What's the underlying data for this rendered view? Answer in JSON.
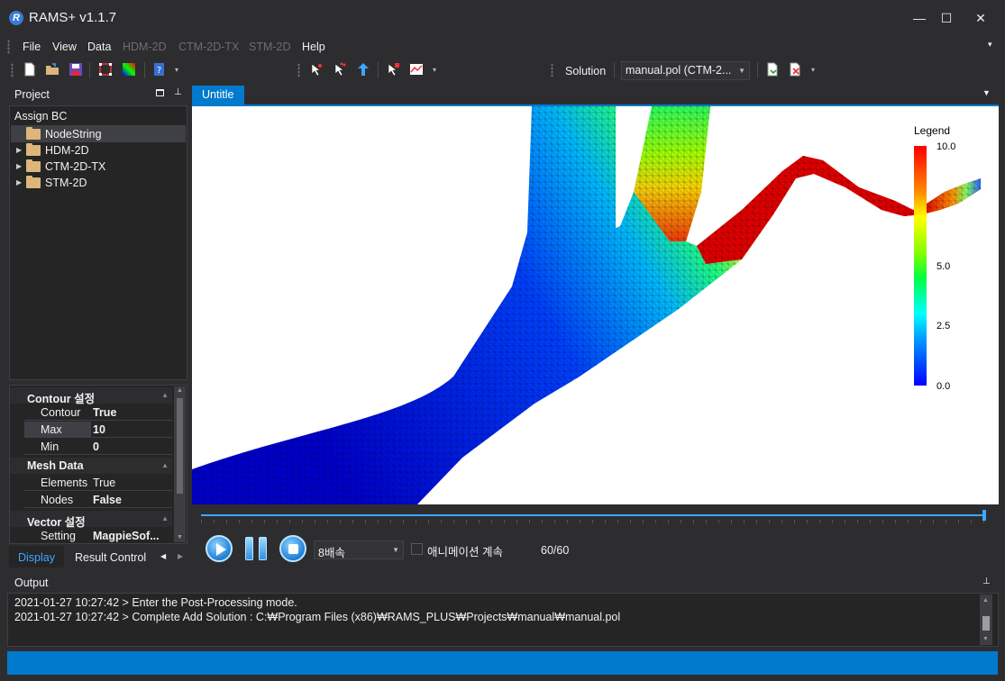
{
  "window": {
    "title": "RAMS+ v1.1.7",
    "logo_letter": "R",
    "minimize": "—",
    "maximize": "☐",
    "close": "✕"
  },
  "menu": [
    {
      "label": "File",
      "disabled": false
    },
    {
      "label": "View",
      "disabled": false
    },
    {
      "label": "Data",
      "disabled": false
    },
    {
      "label": "HDM-2D",
      "disabled": true
    },
    {
      "label": "CTM-2D-TX",
      "disabled": true
    },
    {
      "label": "STM-2D",
      "disabled": true
    },
    {
      "label": "Help",
      "disabled": false
    }
  ],
  "toolbar": {
    "solution_label": "Solution",
    "solution_value": "manual.pol (CTM-2...",
    "icons": [
      "new-file-icon",
      "open-folder-icon",
      "save-icon",
      "select-region-icon",
      "color-map-icon",
      "help-book-icon",
      "pick-node-icon",
      "pick-element-icon",
      "pointer-icon",
      "probe-icon",
      "graph-icon",
      "export-icon",
      "delete-icon"
    ]
  },
  "project": {
    "title": "Project",
    "assign_bc": "Assign BC",
    "tree": [
      {
        "label": "NodeString",
        "expandable": false,
        "selected": true
      },
      {
        "label": "HDM-2D",
        "expandable": true,
        "selected": false
      },
      {
        "label": "CTM-2D-TX",
        "expandable": true,
        "selected": false
      },
      {
        "label": "STM-2D",
        "expandable": true,
        "selected": false
      }
    ]
  },
  "properties": {
    "contour": {
      "title": "Contour 설정",
      "rows": [
        {
          "name": "Contour",
          "value": "True"
        },
        {
          "name": "Max",
          "value": "10"
        },
        {
          "name": "Min",
          "value": "0"
        }
      ]
    },
    "mesh": {
      "title": "Mesh Data",
      "rows": [
        {
          "name": "Elements",
          "value": "True"
        },
        {
          "name": "Nodes",
          "value": "False"
        }
      ]
    },
    "vector": {
      "title": "Vector 설정",
      "rows": [
        {
          "name": "Setting",
          "value": "MagpieSof..."
        }
      ]
    }
  },
  "left_tabs": {
    "display": "Display",
    "result_control": "Result Control"
  },
  "document": {
    "tab": "Untitle"
  },
  "legend": {
    "title": "Legend",
    "ticks": [
      "10.0",
      "5.0",
      "2.5",
      "0.0"
    ],
    "min": 0,
    "max": 10
  },
  "animation": {
    "speed": "8배속",
    "continue_label": "애니메이션 계속",
    "frame_counter": "60/60",
    "progress": 1.0
  },
  "output": {
    "title": "Output",
    "lines": [
      "2021-01-27 10:27:42 > Enter the Post-Processing mode.",
      "2021-01-27 10:27:42 > Complete Add Solution : C:₩Program Files (x86)₩RAMS_PLUS₩Projects₩manual₩manual.pol"
    ]
  },
  "colors": {
    "accent": "#007acc",
    "background": "#2d2d30",
    "panel": "#252526"
  }
}
